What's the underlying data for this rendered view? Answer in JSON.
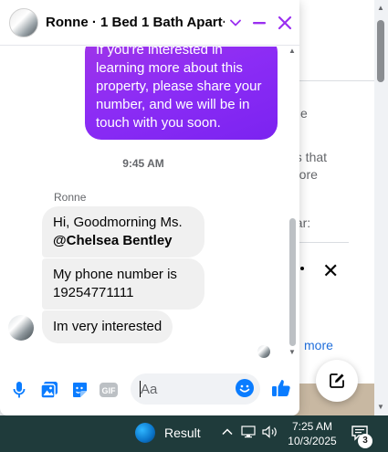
{
  "chat": {
    "title": "Ronne · 1 Bed 1 Bath Apart···",
    "messages": {
      "outgoing_1": "If you're interested in learning more about this property, please share your number, and we will be in touch with you soon.",
      "timestamp": "9:45 AM",
      "sender": "Ronne",
      "incoming_1_text": "Hi, Goodmorning Ms.",
      "incoming_1_mention": "@Chelsea Bentley",
      "incoming_2": "My phone number is 19254771111",
      "incoming_3": "Im very interested"
    },
    "composer": {
      "placeholder": "Aa"
    },
    "accent_color": "#8b2cf5",
    "icon_color": "#0a7cff"
  },
  "background": {
    "snippet_1": "ds that",
    "snippet_2": "more",
    "snippet_3": "ear:",
    "link_more": "more",
    "letter_e": "e"
  },
  "taskbar": {
    "app_label": "Result",
    "time": "7:25 AM",
    "date": "10/3/2025",
    "notification_count": "3"
  }
}
